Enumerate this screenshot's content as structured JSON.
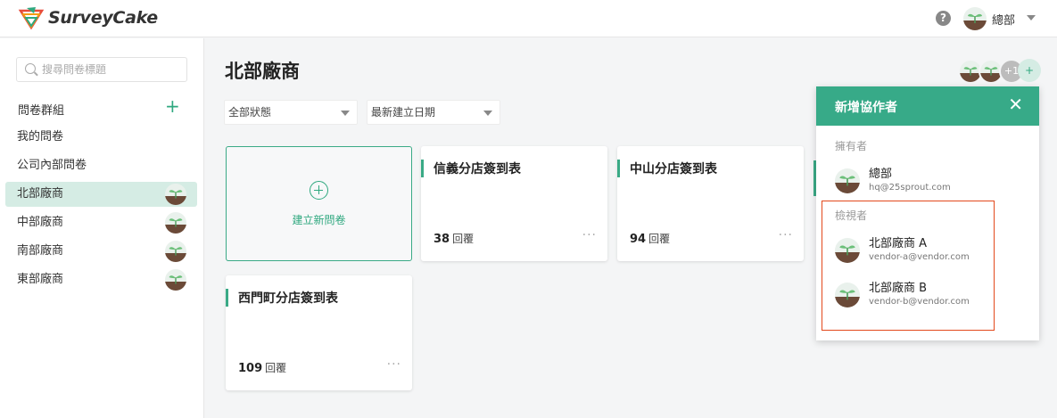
{
  "app": {
    "logo_text": "SurveyCake"
  },
  "topbar": {
    "help_label": "?",
    "user_name": "總部"
  },
  "sidebar": {
    "search_placeholder": "搜尋問卷標題",
    "group_title": "問卷群組",
    "add_label": "+",
    "items": [
      {
        "label": "我的問卷"
      },
      {
        "label": "公司內部問卷"
      },
      {
        "label": "北部廠商",
        "active": true
      },
      {
        "label": "中部廠商"
      },
      {
        "label": "南部廠商"
      },
      {
        "label": "東部廠商"
      }
    ]
  },
  "main": {
    "title": "北部廠商",
    "filter_status": "全部狀態",
    "sort_order": "最新建立日期",
    "new_survey_label": "建立新問卷",
    "cards": [
      {
        "title": "信義分店簽到表",
        "count": "38",
        "response_label": "回覆"
      },
      {
        "title": "中山分店簽到表",
        "count": "94",
        "response_label": "回覆"
      },
      {
        "title": "西門町分店簽到表",
        "count": "109",
        "response_label": "回覆"
      }
    ],
    "more_label": "···",
    "collaborator_extra": "+1",
    "add_collaborator_label": "+"
  },
  "panel": {
    "title": "新增協作者",
    "close_label": "✕",
    "owner_label": "擁有者",
    "owner": {
      "name": "總部",
      "email": "hq@25sprout.com"
    },
    "viewer_label": "檢視者",
    "viewers": [
      {
        "name": "北部廠商 A",
        "email": "vendor-a@vendor.com"
      },
      {
        "name": "北部廠商 B",
        "email": "vendor-b@vendor.com"
      }
    ]
  },
  "colors": {
    "accent": "#37aa88",
    "highlight": "#e3491c",
    "active_bg": "#d5ece4"
  }
}
